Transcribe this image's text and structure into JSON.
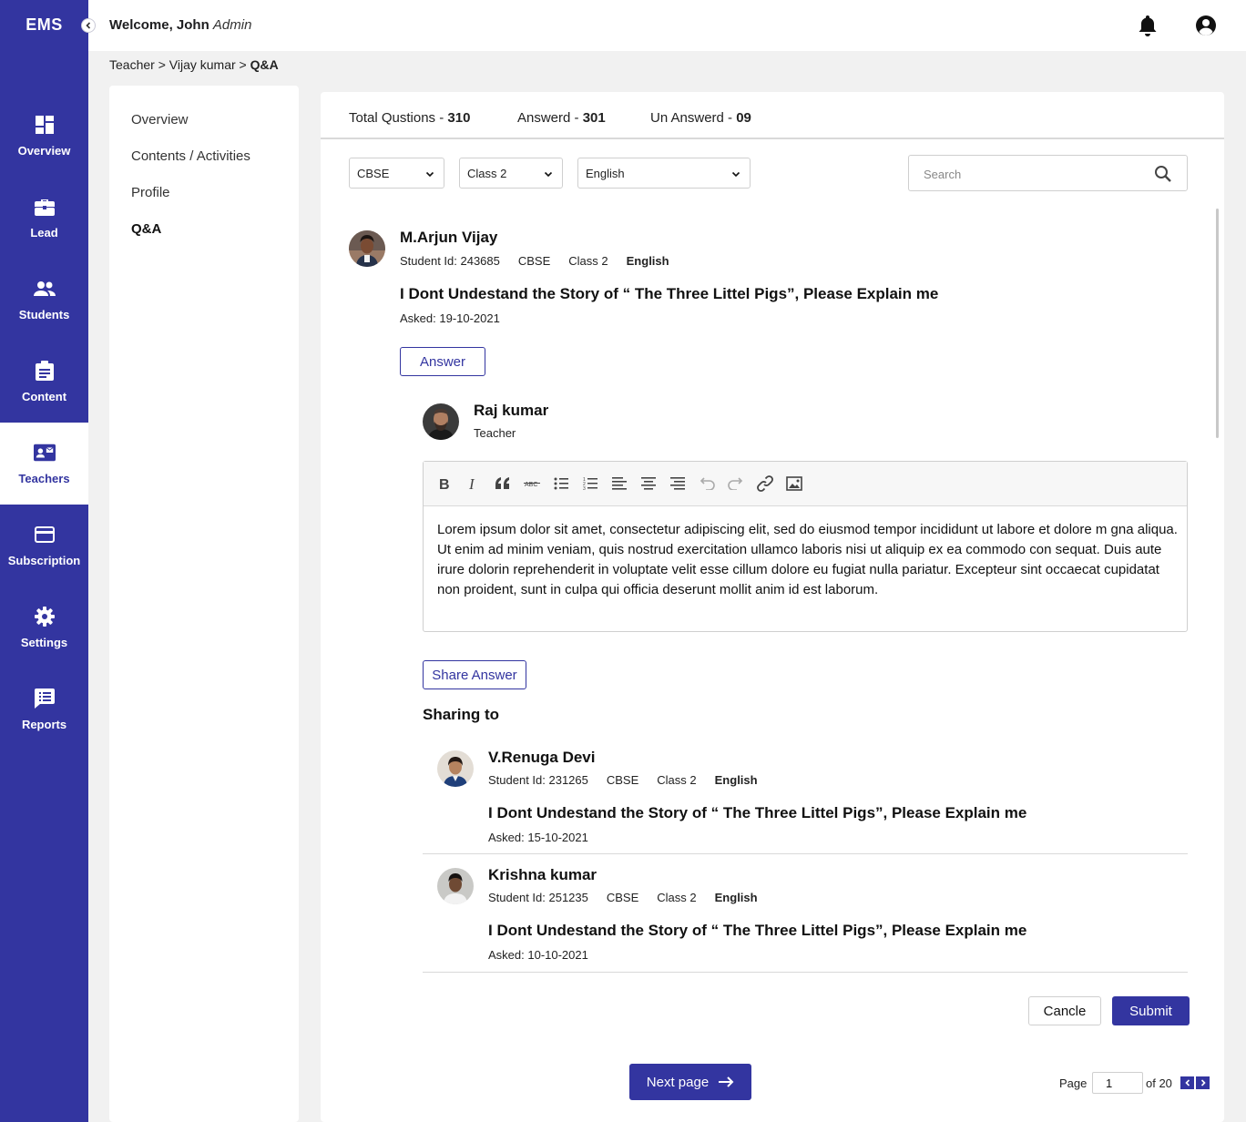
{
  "app": {
    "brand": "EMS"
  },
  "header": {
    "welcome_prefix": "Welcome, John",
    "role": "Admin"
  },
  "sidebar": {
    "items": [
      {
        "label": "Overview",
        "icon": "dashboard-icon"
      },
      {
        "label": "Lead",
        "icon": "briefcase-icon"
      },
      {
        "label": "Students",
        "icon": "people-icon"
      },
      {
        "label": "Content",
        "icon": "clipboard-icon"
      },
      {
        "label": "Teachers",
        "icon": "contact-mail-icon",
        "active": true
      },
      {
        "label": "Subscription",
        "icon": "credit-card-icon"
      },
      {
        "label": "Settings",
        "icon": "gear-icon"
      },
      {
        "label": "Reports",
        "icon": "chat-list-icon"
      }
    ]
  },
  "breadcrumb": {
    "path": "Teacher > Vijay kumar > ",
    "current": "Q&A"
  },
  "subnav": {
    "items": [
      {
        "label": "Overview"
      },
      {
        "label": "Contents / Activities"
      },
      {
        "label": "Profile"
      },
      {
        "label": "Q&A",
        "active": true
      }
    ]
  },
  "stats": {
    "total_label": "Total Qustions - ",
    "total_value": "310",
    "answered_label": "Answerd - ",
    "answered_value": "301",
    "unanswered_label": "Un Answerd - ",
    "unanswered_value": "09"
  },
  "filters": {
    "board": "CBSE",
    "class": "Class 2",
    "subject": "English"
  },
  "search": {
    "placeholder": "Search"
  },
  "question": {
    "student": "M.Arjun Vijay",
    "student_id": "Student Id: 243685",
    "board": "CBSE",
    "class": "Class 2",
    "subject": "English",
    "text": "I Dont Undestand the Story of “ The Three Littel Pigs”, Please Explain me",
    "asked": "Asked: 19-10-2021",
    "answer_button": "Answer"
  },
  "teacher": {
    "name": "Raj kumar",
    "role": "Teacher"
  },
  "editor": {
    "content": "Lorem ipsum dolor sit amet, consectetur adipiscing elit, sed do eiusmod tempor incididunt ut labore et dolore m gna aliqua. Ut enim ad minim veniam, quis nostrud exercitation ullamco laboris nisi ut aliquip ex ea commodo con sequat. Duis aute irure dolorin reprehenderit in voluptate velit esse cillum dolore eu fugiat nulla pariatur. Excepteur  sint occaecat cupidatat non proident, sunt in culpa qui officia deserunt mollit anim id est laborum."
  },
  "share": {
    "button": "Share Answer",
    "title": "Sharing to",
    "students": [
      {
        "name": "V.Renuga Devi",
        "student_id": "Student Id: 231265",
        "board": "CBSE",
        "class": "Class 2",
        "subject": "English",
        "question": "I Dont Undestand the Story of “ The Three Littel Pigs”, Please Explain me",
        "asked": "Asked: 15-10-2021"
      },
      {
        "name": "Krishna kumar",
        "student_id": "Student Id: 251235",
        "board": "CBSE",
        "class": "Class 2",
        "subject": "English",
        "question": "I Dont Undestand the Story of “ The Three Littel Pigs”, Please Explain me",
        "asked": "Asked: 10-10-2021"
      }
    ]
  },
  "actions": {
    "cancel": "Cancle",
    "submit": "Submit",
    "next": "Next page"
  },
  "pagination": {
    "page_label": "Page",
    "current": "1",
    "of_label": "of 20"
  },
  "colors": {
    "primary": "#3335a0",
    "background": "#f1f1f1",
    "border": "#cfcfcf"
  }
}
